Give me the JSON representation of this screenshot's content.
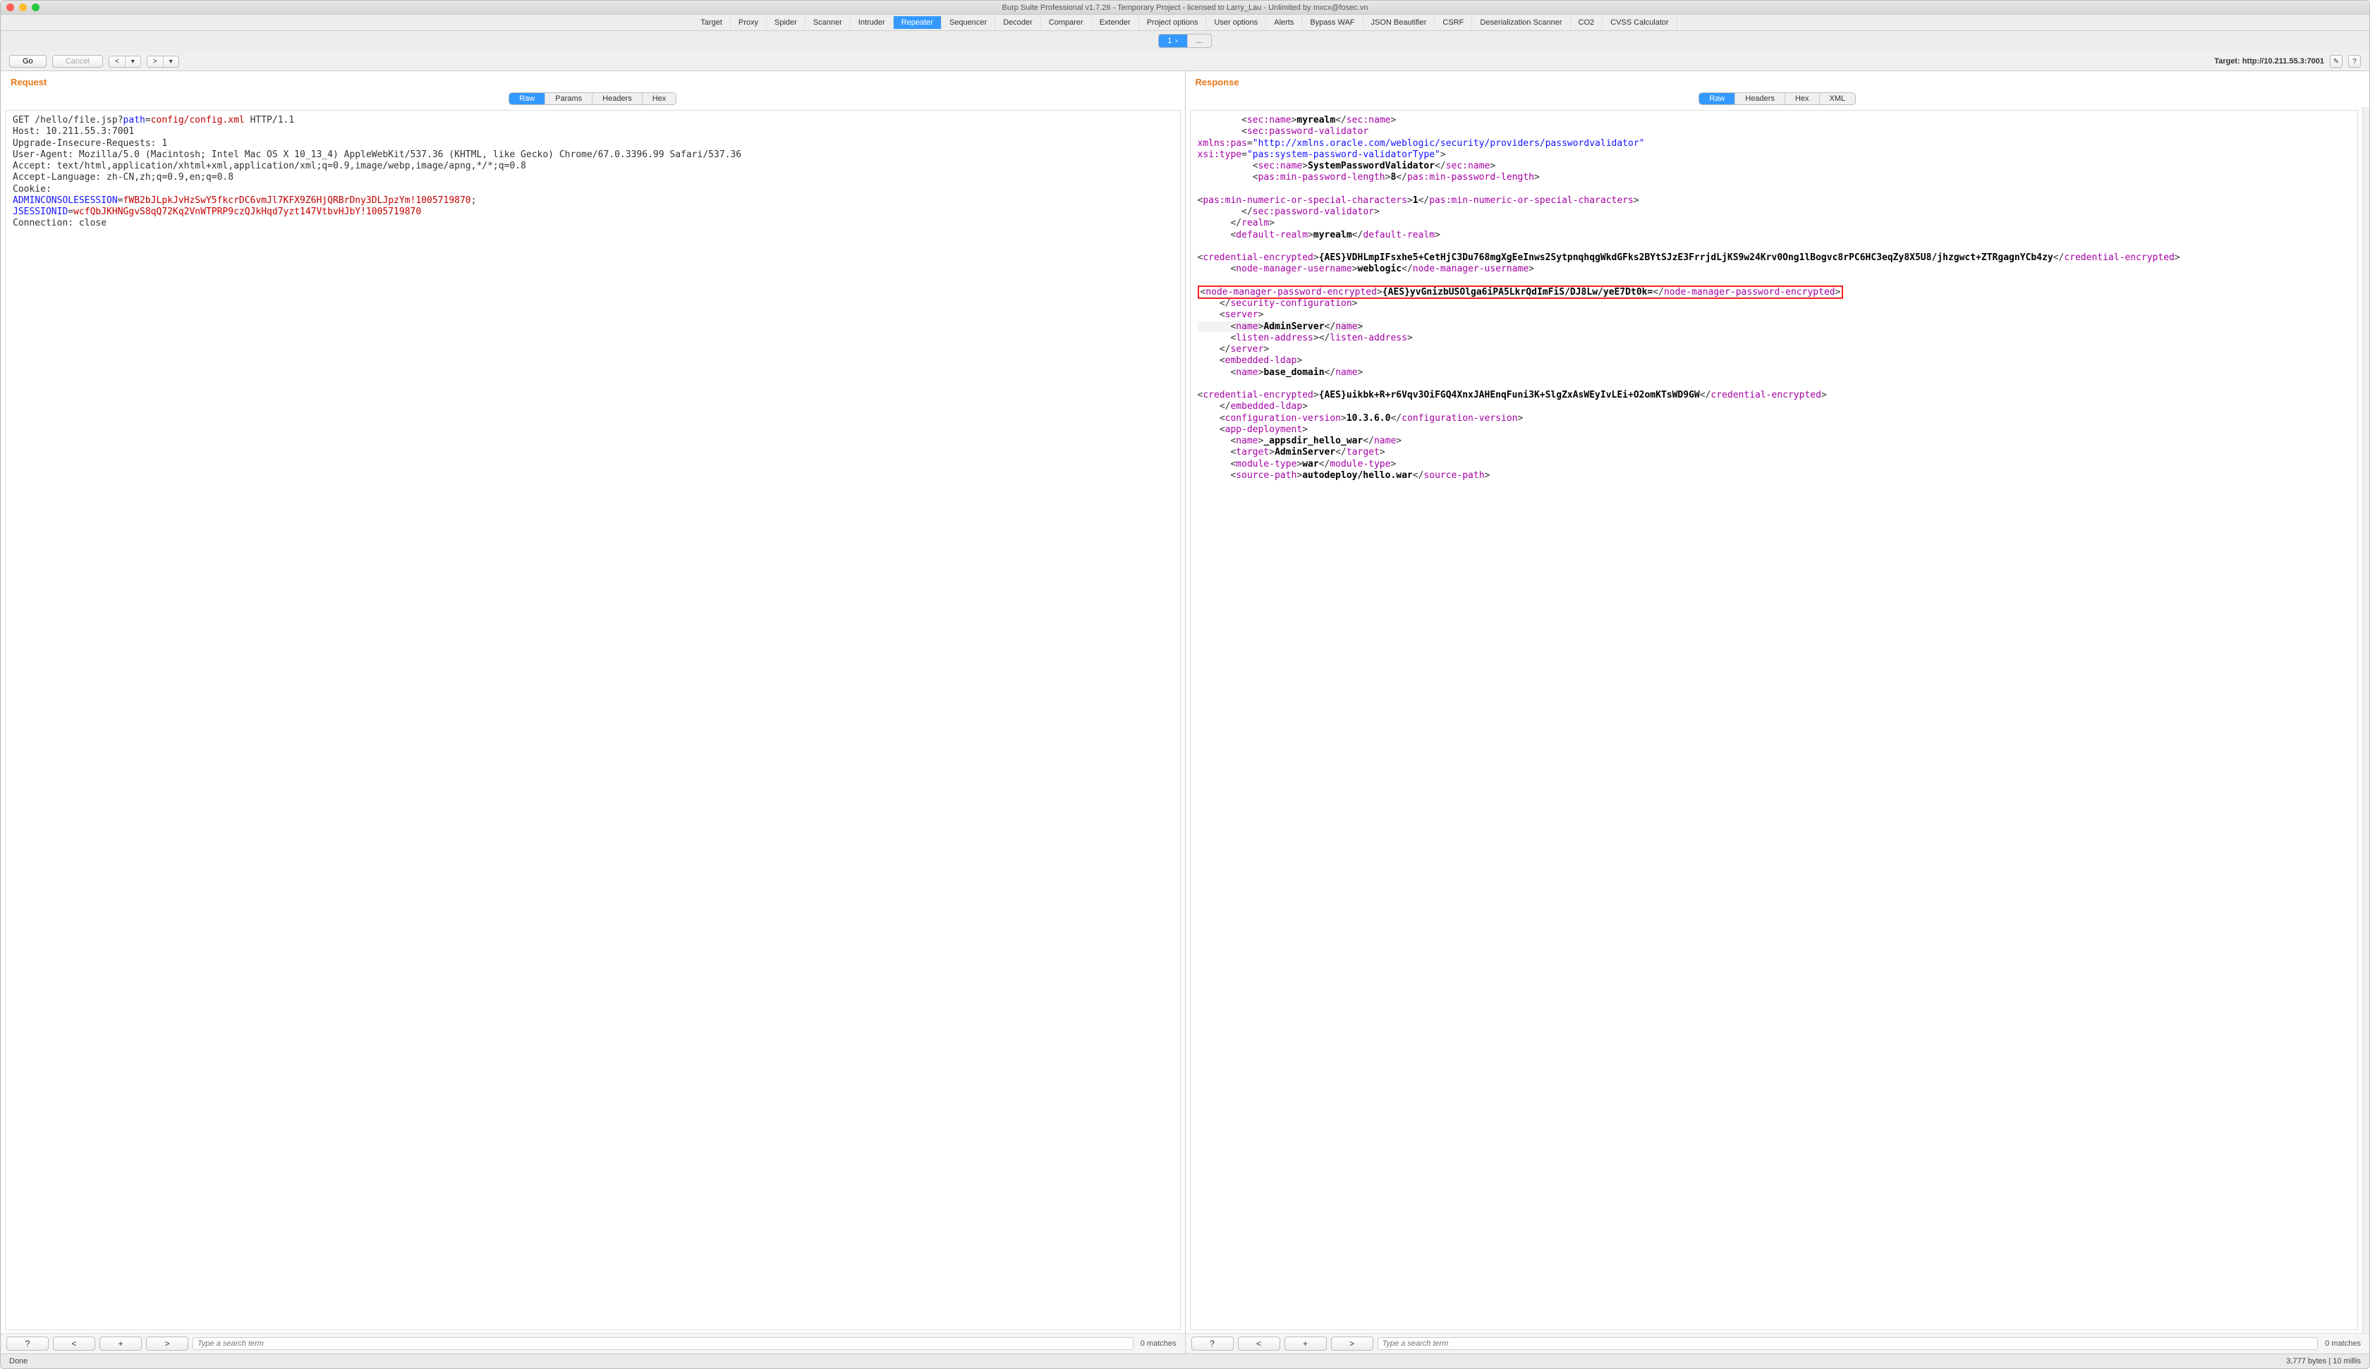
{
  "title": "Burp Suite Professional v1.7.26 - Temporary Project - licensed to Larry_Lau - Unlimited by mxcx@fosec.vn",
  "mainTabs": [
    "Target",
    "Proxy",
    "Spider",
    "Scanner",
    "Intruder",
    "Repeater",
    "Sequencer",
    "Decoder",
    "Comparer",
    "Extender",
    "Project options",
    "User options",
    "Alerts",
    "Bypass WAF",
    "JSON Beautifier",
    "CSRF",
    "Deserialization Scanner",
    "CO2",
    "CVSS Calculator"
  ],
  "mainTabActive": "Repeater",
  "subTabs": {
    "active": "1",
    "close": "×",
    "more": "..."
  },
  "toolbar": {
    "go": "Go",
    "cancel": "Cancel",
    "navBack": "<",
    "navBackDrop": "▾",
    "navFwd": ">",
    "navFwdDrop": "▾",
    "targetLabel": "Target: http://10.211.55.3:7001",
    "pencil": "✎",
    "help": "?"
  },
  "request": {
    "header": "Request",
    "tabs": [
      "Raw",
      "Params",
      "Headers",
      "Hex"
    ],
    "tabActive": "Raw",
    "lines": {
      "l1a": "GET /hello/file.jsp?",
      "l1b": "path",
      "l1c": "=",
      "l1d": "config/config.xml",
      "l1e": " HTTP/1.1",
      "l2": "Host: 10.211.55.3:7001",
      "l3": "Upgrade-Insecure-Requests: 1",
      "l4": "User-Agent: Mozilla/5.0 (Macintosh; Intel Mac OS X 10_13_4) AppleWebKit/537.36 (KHTML, like Gecko) Chrome/67.0.3396.99 Safari/537.36",
      "l5": "Accept: text/html,application/xhtml+xml,application/xml;q=0.9,image/webp,image/apng,*/*;q=0.8",
      "l6": "Accept-Language: zh-CN,zh;q=0.9,en;q=0.8",
      "l7": "Cookie: ",
      "l7a": "ADMINCONSOLESESSION",
      "l7b": "=",
      "l7c": "fWB2bJLpkJvHzSwY5fkcrDC6vmJl7KFX9Z6HjQRBrDny3DLJpzYm!1005719870",
      "l7d": "; ",
      "l7e": "JSESSIONID",
      "l7f": "=",
      "l7g": "wcfQbJKHNGgvS8qQ72Kq2VnWTPRP9czQJkHqd7yzt147VtbvHJbY!1005719870",
      "l8": "Connection: close"
    }
  },
  "response": {
    "header": "Response",
    "tabs": [
      "Raw",
      "Headers",
      "Hex",
      "XML"
    ],
    "tabActive": "Raw",
    "xml": {
      "secname_open": "sec:name",
      "myrealm": "myrealm",
      "secpwv": "sec:password-validator",
      "xmlns": "xmlns:pas",
      "xmlns_val": "\"http://xmlns.oracle.com/weblogic/security/providers/passwordvalidator\"",
      "xsitype": "xsi:type",
      "xsitype_val": "\"pas:system-password-validatorType\"",
      "spv": "SystemPasswordValidator",
      "pasmin": "pas:min-password-length",
      "eight": "8",
      "pasminnum": "pas:min-numeric-or-special-characters",
      "one": "1",
      "realm": "realm",
      "defrealm": "default-realm",
      "credenc": "credential-encrypted",
      "cred1": "{AES}VDHLmpIFsxhe5+CetHjC3Du768mgXgEeInws2SytpnqhqgWkdGFks2BYtSJzE3FrrjdLjKS9w24Krv0Ong1lBogvc8rPC6HC3eqZy8X5U8/jhzgwct+ZTRgagnYCb4zy",
      "nodemgruser": "node-manager-username",
      "weblogic": "weblogic",
      "nodemgrpwd": "node-manager-password-encrypted",
      "pwdval": "{AES}yvGnizbUSOlga6iPA5LkrQdImFiS/DJ8Lw/yeE7Dt0k=",
      "seccfg": "security-configuration",
      "server": "server",
      "name": "name",
      "adminserver": "AdminServer",
      "listenaddr": "listen-address",
      "embldap": "embedded-ldap",
      "basedomain": "base_domain",
      "cred2": "{AES}uikbk+R+r6Vqv3OiFGQ4XnxJAHEnqFuni3K+SlgZxAsWEyIvLEi+O2omKTsWD9GW",
      "cfgver": "configuration-version",
      "ver": "10.3.6.0",
      "appdep": "app-deployment",
      "appname": "_appsdir_hello_war",
      "target": "target",
      "modtype": "module-type",
      "war": "war",
      "srcpath": "source-path",
      "autodeploy": "autodeploy/hello.war"
    }
  },
  "footer": {
    "q": "?",
    "lt": "<",
    "plus": "+",
    "gt": ">",
    "placeholder": "Type a search term",
    "matches": "0 matches"
  },
  "status": {
    "left": "Done",
    "right": "3,777 bytes | 10 millis"
  }
}
